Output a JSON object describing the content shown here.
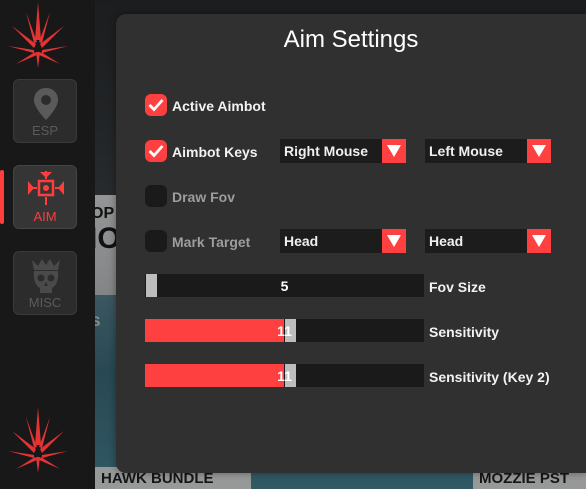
{
  "panel": {
    "title": "Aim Settings"
  },
  "sidebar": {
    "tabs": [
      {
        "label": "ESP",
        "icon": "map-pin-icon",
        "active": false
      },
      {
        "label": "AIM",
        "icon": "crosshair-icon",
        "active": true
      },
      {
        "label": "MISC",
        "icon": "skull-icon",
        "active": false
      }
    ],
    "logo": "starburst-logo"
  },
  "rows": {
    "active_aimbot": {
      "label": "Active Aimbot",
      "checked": true
    },
    "aimbot_keys": {
      "label": "Aimbot Keys",
      "checked": true,
      "key1": "Right Mouse",
      "key2": "Left Mouse"
    },
    "draw_fov": {
      "label": "Draw Fov",
      "checked": false
    },
    "mark_target": {
      "label": "Mark Target",
      "checked": false,
      "bone1": "Head",
      "bone2": "Head"
    }
  },
  "sliders": {
    "fov_size": {
      "label": "Fov Size",
      "value": "5",
      "fraction": 0.0
    },
    "sensitivity": {
      "label": "Sensitivity",
      "value": "11",
      "fraction": 0.52
    },
    "sensitivity_key2": {
      "label": "Sensitivity (Key 2)",
      "value": "11",
      "fraction": 0.52
    }
  },
  "background": {
    "text_op": "OP",
    "text_io": "IO",
    "text_s": "S",
    "bundle_left": "HAWK BUNDLE",
    "bundle_right": "MOZZIE PST"
  },
  "colors": {
    "accent": "#ff4040",
    "panel": "#303030",
    "sidebar": "#181818"
  }
}
